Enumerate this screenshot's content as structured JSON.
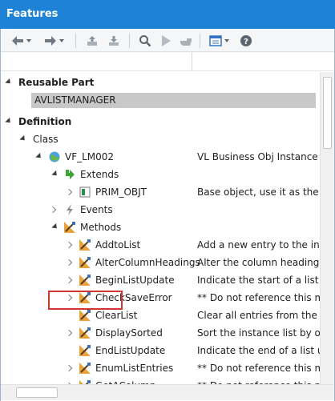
{
  "window": {
    "title": "Features"
  },
  "toolbar": {
    "buttons": [
      {
        "name": "back-button",
        "icon": "arrow-left-icon",
        "has_dropdown": true
      },
      {
        "name": "forward-button",
        "icon": "arrow-right-icon",
        "has_dropdown": true
      },
      {
        "name": "export-button",
        "icon": "export-icon"
      },
      {
        "name": "import-button",
        "icon": "import-icon"
      },
      {
        "name": "find-button",
        "icon": "magnifier-icon"
      },
      {
        "name": "run-button",
        "icon": "play-icon"
      },
      {
        "name": "pointer-button",
        "icon": "pointing-hand-icon"
      },
      {
        "name": "view-button",
        "icon": "view-list-icon",
        "has_dropdown": true
      },
      {
        "name": "help-button",
        "icon": "help-icon"
      }
    ]
  },
  "tree": {
    "reusable_part": {
      "label": "Reusable Part",
      "value": "AVLISTMANAGER"
    },
    "definition": {
      "label": "Definition"
    },
    "class": {
      "label": "Class"
    },
    "component": {
      "name": "VF_LM002",
      "description": "VL Business Obj Instance List",
      "icon": "component-globe-icon"
    },
    "extends": {
      "label": "Extends",
      "icon": "green-arrow-icon"
    },
    "base": {
      "name": "PRIM_OBJT",
      "description": "Base object, use it as the ancestor",
      "icon": "object-icon"
    },
    "events": {
      "label": "Events",
      "icon": "lightning-icon"
    },
    "methods": {
      "label": "Methods",
      "icon": "method-icon"
    },
    "method_items": [
      {
        "name": "AddtoList",
        "description": "Add a new entry to the instance list"
      },
      {
        "name": "AlterColumnHeadings",
        "description": "Alter the column headings in the list"
      },
      {
        "name": "BeginListUpdate",
        "description": "Indicate the start of a list update"
      },
      {
        "name": "CheckSaveError",
        "description": "** Do not reference this method"
      },
      {
        "name": "ClearList",
        "description": "Clear all entries from the instance list"
      },
      {
        "name": "DisplaySorted",
        "description": "Sort the instance list by one column"
      },
      {
        "name": "EndListUpdate",
        "description": "Indicate the end of a list update"
      },
      {
        "name": "EnumListEntries",
        "description": "** Do not reference this method"
      },
      {
        "name": "GetAColumn",
        "description": "** Do not reference this method"
      }
    ]
  },
  "colors": {
    "titlebar": "#1e82d6",
    "highlight_border": "#d0362f",
    "selection_bg": "#c8c8c8"
  }
}
